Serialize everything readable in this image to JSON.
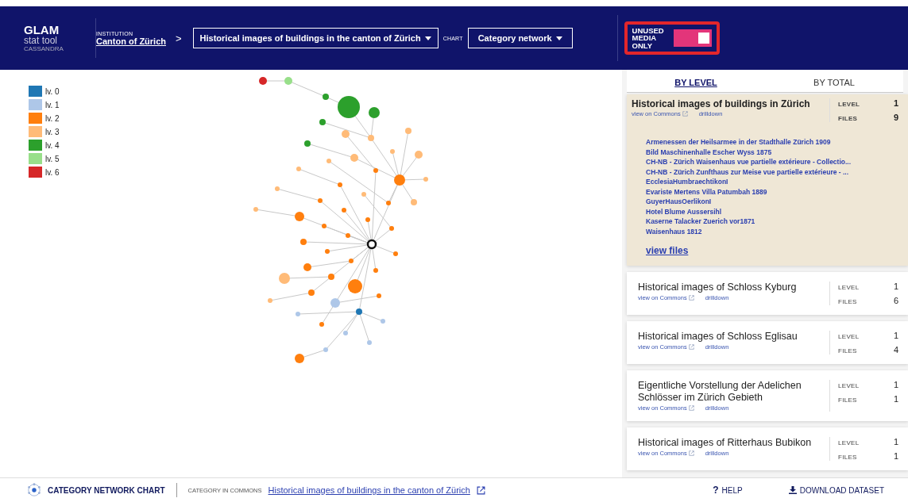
{
  "header": {
    "logo": {
      "title": "GLAM",
      "subtitle": "stat tool",
      "edition": "CASSANDRA"
    },
    "institution": {
      "label": "INSTITUTION",
      "value": "Canton of Zürich"
    },
    "separator": ">",
    "category_select": {
      "value": "Historical images of buildings in the canton of Zürich"
    },
    "chart_label": "CHART",
    "chart_select": {
      "value": "Category network"
    },
    "unused_toggle": {
      "label": "UNUSED MEDIA ONLY",
      "on": true,
      "highlighted": true
    }
  },
  "legend": [
    {
      "label": "lv. 0",
      "color": "#1f77b4"
    },
    {
      "label": "lv. 1",
      "color": "#aec7e8"
    },
    {
      "label": "lv. 2",
      "color": "#ff7f0e"
    },
    {
      "label": "lv. 3",
      "color": "#ffbb78"
    },
    {
      "label": "lv. 4",
      "color": "#2ca02c"
    },
    {
      "label": "lv. 5",
      "color": "#98df8a"
    },
    {
      "label": "lv. 6",
      "color": "#d62728"
    }
  ],
  "sidebar": {
    "tabs": [
      {
        "label": "BY LEVEL",
        "selected": true
      },
      {
        "label": "BY TOTAL",
        "selected": false
      }
    ],
    "cards": [
      {
        "title": "Historical images of buildings in Zürich",
        "commons_link": "view on Commons",
        "drilldown_link": "drilldown",
        "level_label": "LEVEL",
        "level": "1",
        "files_label": "FILES",
        "files": "9",
        "expanded": true,
        "file_list": [
          "Armenessen der Heilsarmee in der Stadthalle Zürich 1909",
          "Bild Maschinenhalle Escher Wyss 1875",
          "CH-NB - Zürich Waisenhaus vue partielle extérieure - Collectio...",
          "CH-NB - Zürich Zunfthaus zur Meise vue partielle extérieure - ...",
          "EcclesiaHumbraechtikonI",
          "Evariste Mertens Villa Patumbah 1889",
          "GuyerHausOerlikonI",
          "Hotel Blume Aussersihl",
          "Kaserne Talacker Zuerich vor1871",
          "Waisenhaus 1812"
        ],
        "view_files": "view files"
      },
      {
        "title": "Historical images of Schloss Kyburg",
        "commons_link": "view on Commons",
        "drilldown_link": "drilldown",
        "level_label": "LEVEL",
        "level": "1",
        "files_label": "FILES",
        "files": "6",
        "expanded": false
      },
      {
        "title": "Historical images of Schloss Eglisau",
        "commons_link": "view on Commons",
        "drilldown_link": "drilldown",
        "level_label": "LEVEL",
        "level": "1",
        "files_label": "FILES",
        "files": "4",
        "expanded": false
      },
      {
        "title": "Eigentliche Vorstellung der Adelichen Schlösser im Zürich Gebieth",
        "commons_link": "view on Commons",
        "drilldown_link": "drilldown",
        "level_label": "LEVEL",
        "level": "1",
        "files_label": "FILES",
        "files": "1",
        "expanded": false
      },
      {
        "title": "Historical images of Ritterhaus Bubikon",
        "commons_link": "view on Commons",
        "drilldown_link": "drilldown",
        "level_label": "LEVEL",
        "level": "1",
        "files_label": "FILES",
        "files": "1",
        "expanded": false
      }
    ]
  },
  "footer": {
    "chart_name": "CATEGORY NETWORK CHART",
    "commons_label": "CATEGORY IN COMMONS",
    "commons_link": "Historical images of buildings in the canton of Zürich",
    "help_mark": "?",
    "help": "HELP",
    "download": "DOWNLOAD DATASET"
  }
}
